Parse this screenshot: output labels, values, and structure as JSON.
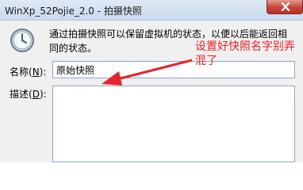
{
  "window": {
    "title": "WinXp_52Pojie_2.0 - 拍摄快照"
  },
  "dialog": {
    "description": "通过拍摄快照可以保留虚拟机的状态，以便以后能返回相同的状态。",
    "name_label_text": "名称(",
    "name_label_key": "N",
    "name_label_end": "):",
    "name_value": "原始快照",
    "desc_label_text": "描述(",
    "desc_label_key": "D",
    "desc_label_end": "):",
    "desc_value": ""
  },
  "annotation": {
    "text": "设置好快照名字别弄混了",
    "color": "#e8222b"
  },
  "icons": {
    "window_close": "close-icon",
    "snapshot": "clock-icon",
    "pointer": "arrow-icon"
  }
}
